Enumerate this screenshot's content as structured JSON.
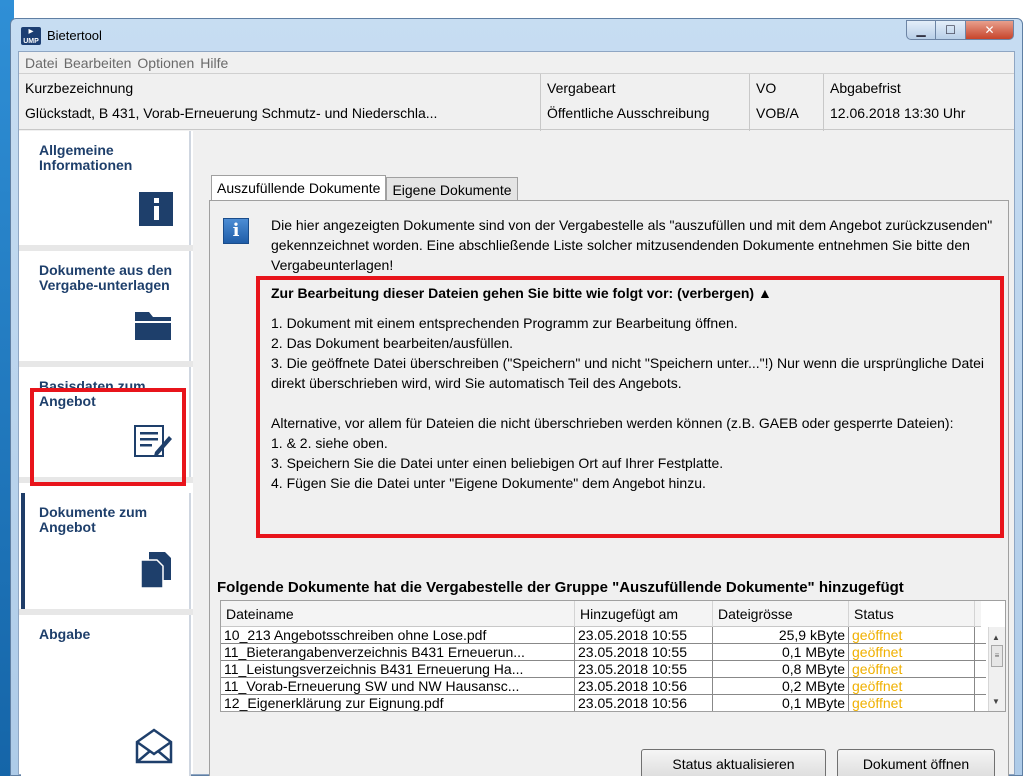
{
  "window": {
    "title": "Bietertool",
    "app_icon_text": "UMP"
  },
  "menu": [
    "Datei",
    "Bearbeiten",
    "Optionen",
    "Hilfe"
  ],
  "info": {
    "kurz_label": "Kurzbezeichnung",
    "kurz_value": "Glückstadt, B 431, Vorab-Erneuerung Schmutz- und Niederschla...",
    "art_label": "Vergabeart",
    "art_value": "Öffentliche Ausschreibung",
    "vo_label": "VO",
    "vo_value": "VOB/A",
    "frist_label": "Abgabefrist",
    "frist_value": "12.06.2018 13:30 Uhr"
  },
  "nav": [
    {
      "label": "Allgemeine Informationen",
      "icon": "info-icon"
    },
    {
      "label": "Dokumente aus den Vergabe-unterlagen",
      "icon": "folder-icon"
    },
    {
      "label": "Basisdaten zum Angebot",
      "icon": "form-edit-icon"
    },
    {
      "label": "Dokumente zum Angebot",
      "icon": "documents-icon"
    },
    {
      "label": "Abgabe",
      "icon": "envelope-icon"
    }
  ],
  "tabs": [
    "Auszufüllende Dokumente",
    "Eigene Dokumente"
  ],
  "intro_text": "Die hier angezeigten Dokumente sind von der Vergabestelle als \"auszufüllen und mit dem Angebot zurückzusenden\" gekennzeichnet worden. Eine abschließende Liste solcher mitzusendenden Dokumente entnehmen Sie bitte den Vergabeunterlagen!",
  "steps": {
    "heading": "Zur Bearbeitung dieser Dateien gehen Sie bitte wie folgt vor: (verbergen) ▲",
    "lines": [
      "1. Dokument mit einem entsprechenden Programm zur Bearbeitung öffnen.",
      "2. Das Dokument bearbeiten/ausfüllen.",
      "3. Die geöffnete Datei überschreiben (\"Speichern\" und nicht \"Speichern unter...\"!) Nur wenn die ursprüngliche Datei direkt überschrieben wird, wird Sie automatisch Teil des Angebots."
    ],
    "alt_lines": [
      "Alternative, vor allem für Dateien die nicht überschrieben werden können (z.B. GAEB oder gesperrte Dateien):",
      "1. & 2. siehe oben.",
      "3. Speichern Sie die Datei unter einen beliebigen Ort auf Ihrer Festplatte.",
      "4. Fügen Sie die Datei unter \"Eigene Dokumente\" dem Angebot hinzu."
    ]
  },
  "table": {
    "heading": "Folgende Dokumente hat die Vergabestelle der Gruppe \"Auszufüllende Dokumente\" hinzugefügt",
    "columns": [
      "Dateiname",
      "Hinzugefügt am",
      "Dateigrösse",
      "Status"
    ],
    "rows": [
      [
        "10_213 Angebotsschreiben ohne Lose.pdf",
        "23.05.2018 10:55",
        "25,9 kByte",
        "geöffnet"
      ],
      [
        "11_Bieterangabenverzeichnis B431 Erneuerun...",
        "23.05.2018 10:55",
        "0,1 MByte",
        "geöffnet"
      ],
      [
        "11_Leistungsverzeichnis B431 Erneuerung Ha...",
        "23.05.2018 10:55",
        "0,8 MByte",
        "geöffnet"
      ],
      [
        "11_Vorab-Erneuerung SW und NW Hausansc...",
        "23.05.2018 10:56",
        "0,2 MByte",
        "geöffnet"
      ],
      [
        "12_Eigenerklärung zur Eignung.pdf",
        "23.05.2018 10:56",
        "0,1 MByte",
        "geöffnet"
      ]
    ]
  },
  "buttons": {
    "refresh": "Status aktualisieren",
    "open": "Dokument öffnen"
  },
  "colors": {
    "nav_text": "#1e3f6b",
    "highlight": "#e8141b",
    "status": "#f0b000"
  }
}
